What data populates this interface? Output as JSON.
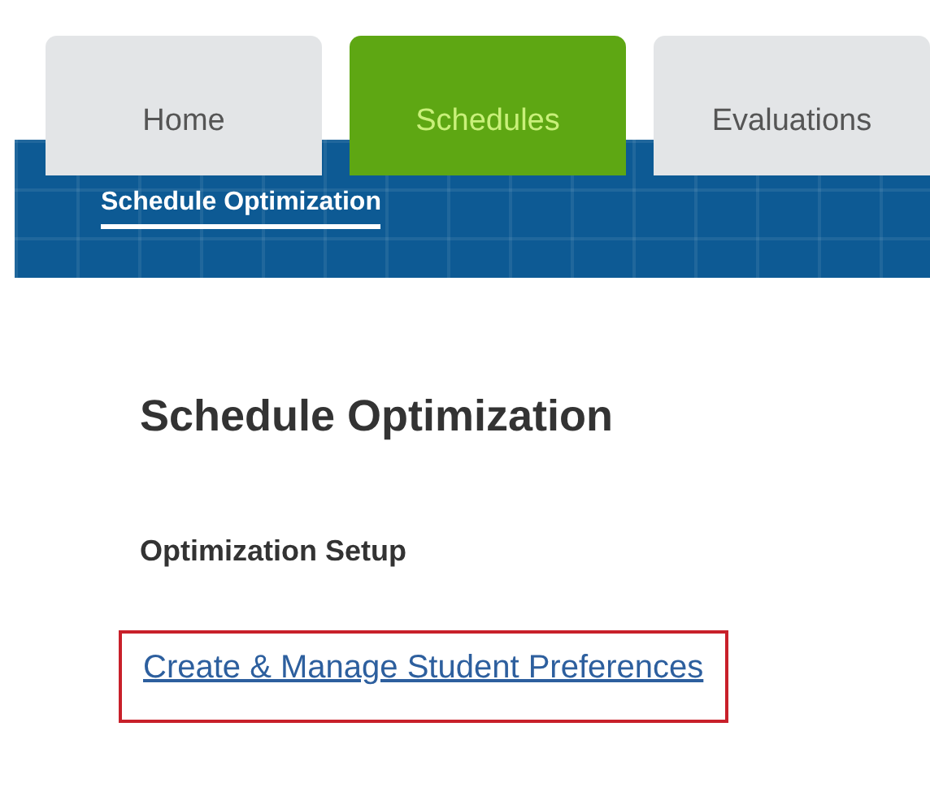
{
  "tabs": [
    {
      "label": "Home",
      "selected": false
    },
    {
      "label": "Schedules",
      "selected": true
    },
    {
      "label": "Evaluations",
      "selected": false
    }
  ],
  "subnav": {
    "items": [
      {
        "label": "Schedule Optimization",
        "selected": true
      }
    ]
  },
  "page": {
    "title": "Schedule Optimization",
    "section": "Optimization Setup",
    "links": [
      {
        "label": "Create & Manage Student Preferences",
        "highlighted": true
      }
    ]
  }
}
